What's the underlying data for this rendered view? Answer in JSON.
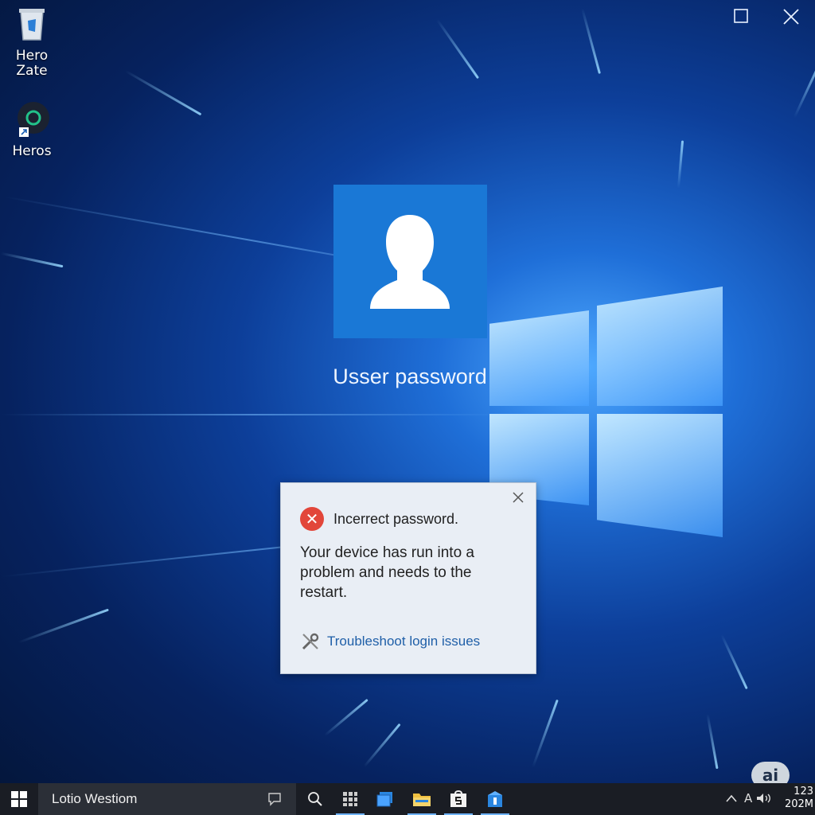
{
  "window_controls": {
    "maximize_icon": "maximize-icon",
    "close_icon": "close-icon"
  },
  "desktop_icons": [
    {
      "label_line1": "Hero",
      "label_line2": "Zate",
      "icon": "recycle-bin-icon"
    },
    {
      "label_line1": "Heros",
      "label_line2": "",
      "icon": "app-ring-icon"
    }
  ],
  "login": {
    "user_label": "Usser password",
    "avatar_icon": "user-silhouette-icon"
  },
  "dialog": {
    "title": "Incerrect password.",
    "body": "Your device has run into a problem and needs to the restart.",
    "link": "Troubleshoot login issues",
    "error_icon": "error-icon",
    "link_icon": "tools-icon"
  },
  "taskbar": {
    "search_text": "Lotio Westiom",
    "clock_line1": "123",
    "clock_line2": "202M",
    "tray_text": "A"
  },
  "badge": {
    "text": "ai"
  },
  "colors": {
    "accent": "#1a78d6",
    "error": "#e2463a",
    "link": "#1f5fa8",
    "taskbar": "#1a1d24"
  }
}
